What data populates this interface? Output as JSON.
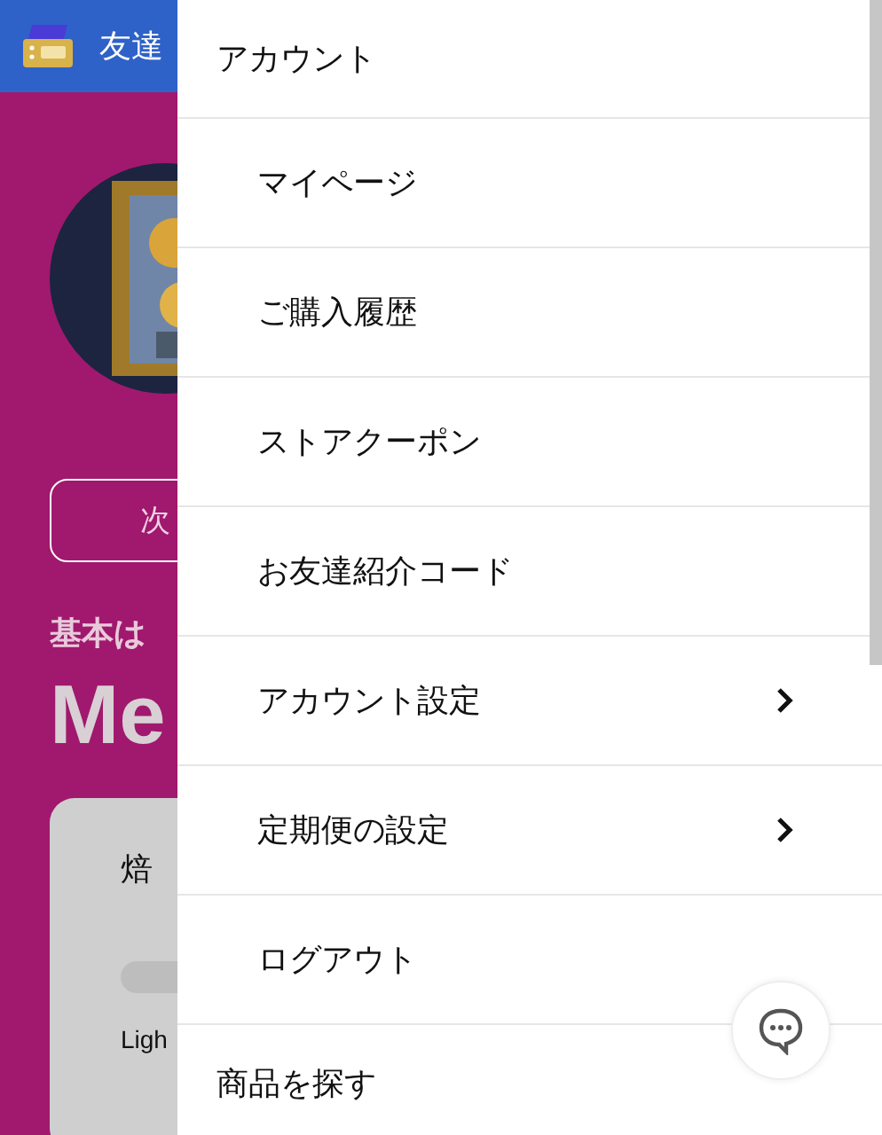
{
  "header": {
    "title": "友達"
  },
  "page": {
    "next_button": "次",
    "subtitle": "基本は",
    "heading": "Me",
    "card": {
      "title": "焙",
      "slider_label": "Ligh"
    }
  },
  "drawer": {
    "sections": [
      {
        "title": "アカウント",
        "items": [
          {
            "label": "マイページ",
            "has_submenu": false
          },
          {
            "label": "ご購入履歴",
            "has_submenu": false
          },
          {
            "label": "ストアクーポン",
            "has_submenu": false
          },
          {
            "label": "お友達紹介コード",
            "has_submenu": false
          },
          {
            "label": "アカウント設定",
            "has_submenu": true
          },
          {
            "label": "定期便の設定",
            "has_submenu": true
          },
          {
            "label": "ログアウト",
            "has_submenu": false
          }
        ]
      },
      {
        "title": "商品を探す"
      }
    ]
  }
}
